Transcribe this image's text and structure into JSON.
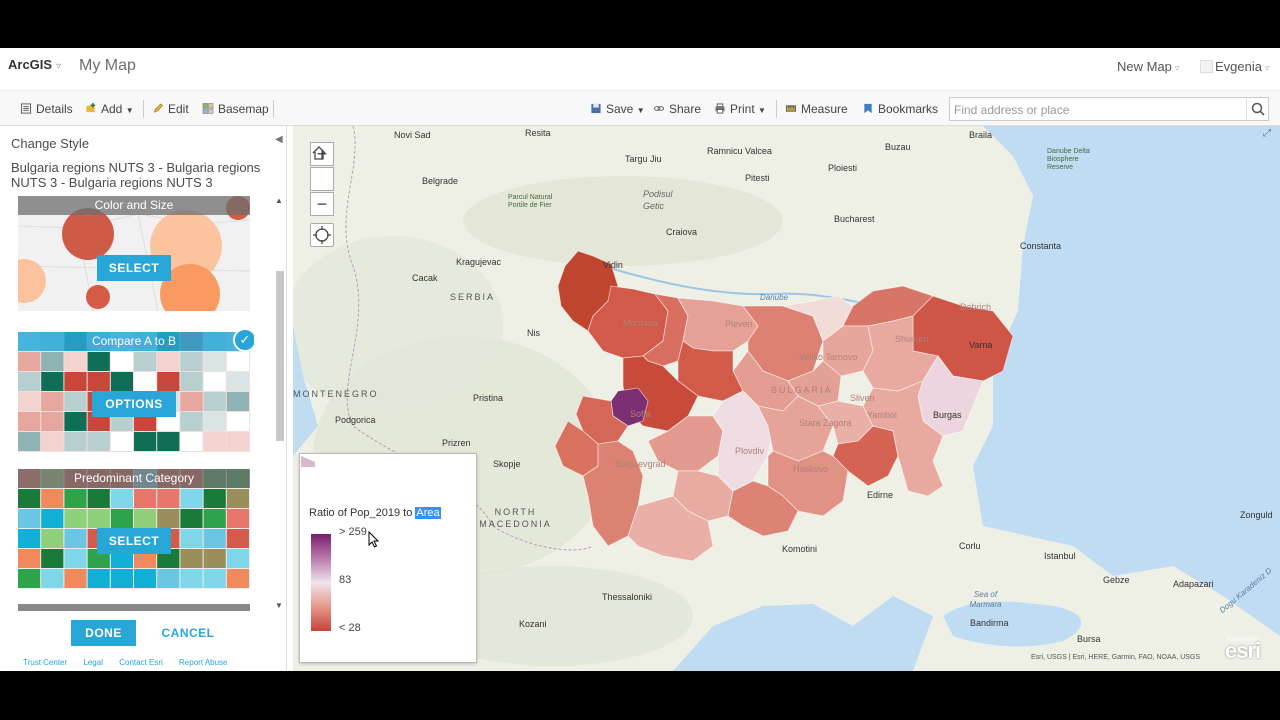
{
  "header": {
    "brand": "ArcGIS",
    "map_title": "My Map",
    "new_map": "New Map",
    "user": "Evgenia"
  },
  "toolbar": {
    "details": "Details",
    "add": "Add",
    "edit": "Edit",
    "basemap": "Basemap",
    "save": "Save",
    "share": "Share",
    "print": "Print",
    "measure": "Measure",
    "bookmarks": "Bookmarks",
    "search_placeholder": "Find address or place"
  },
  "panel": {
    "title": "Change Style",
    "layer": "Bulgaria regions NUTS 3 - Bulgaria regions NUTS 3 - Bulgaria regions NUTS 3",
    "cards": [
      {
        "title": "Color and Size",
        "button": "SELECT"
      },
      {
        "title": "Compare A to B",
        "button": "OPTIONS",
        "selected": true
      },
      {
        "title": "Predominant Category",
        "button": "SELECT"
      }
    ],
    "done": "DONE",
    "cancel": "CANCEL",
    "footer_links": [
      "Trust Center",
      "Legal",
      "Contact Esri",
      "Report Abuse"
    ]
  },
  "map": {
    "labels": {
      "novi_sad": "Novi Sad",
      "resita": "Resita",
      "targu_jiu": "Targu Jiu",
      "ramnicu_valcea": "Ramnicu Valcea",
      "buzau": "Buzau",
      "braila": "Braila",
      "danube_delta": "Danube Delta Biosphere Reserve",
      "belgrade": "Belgrade",
      "portile": "Parcul Natural Portile de Fier",
      "podisul": "Podisul Getic",
      "pitesti": "Pitesti",
      "ploiesti": "Ploiesti",
      "bucharest": "Bucharest",
      "craiova": "Craiova",
      "constanta": "Constanta",
      "kragujevac": "Kragujevac",
      "cacak": "Cacak",
      "serbia": "SERBIA",
      "vidin": "Vidin",
      "danube": "Danube",
      "montana": "Montana",
      "pleven": "Pleven",
      "dobrich": "Dobrich",
      "shumen": "Shumen",
      "varna": "Varna",
      "veliko": "Veliko Tarnovo",
      "nis": "Nis",
      "bulgaria": "BULGARIA",
      "montenegro": "MONTENEGRO",
      "pristina": "Pristina",
      "sofia": "Sofia",
      "sliven": "Sliven",
      "yambol": "Yambol",
      "burgas": "Burgas",
      "podgorica": "Podgorica",
      "stara_zagora": "Stara Zagora",
      "prizren": "Prizren",
      "blagoevgrad": "Blagoevgrad",
      "plovdiv": "Plovdiv",
      "haskovo": "Haskovo",
      "skopje": "Skopje",
      "edirne": "Edirne",
      "north_macedonia": "NORTH MACEDONIA",
      "komotini": "Komotini",
      "corlu": "Corlu",
      "istanbul": "Istanbul",
      "zonguldak": "Zonguld",
      "thessaloniki": "Thessaloniki",
      "gebze": "Gebze",
      "adapazari": "Adapazari",
      "sea_marmara": "Sea of Marmara",
      "kozani": "Kozani",
      "bandirma": "Bandirma",
      "bursa": "Bursa",
      "black_sea_coast": "Dogu Karadeniz D"
    },
    "attribution": "Esri, USGS | Esri, HERE, Garmin, FAO, NOAA, USGS",
    "esri_logo": "esri",
    "powered_by": "POWERED BY"
  },
  "legend": {
    "title_prefix": "Ratio of Pop_2019 to ",
    "title_field": "Area",
    "high": "> 259",
    "mid": "83",
    "low": "< 28",
    "colors": {
      "high": "#7b1e6e",
      "mid": "#f0e4ee",
      "low": "#c8443a"
    }
  }
}
